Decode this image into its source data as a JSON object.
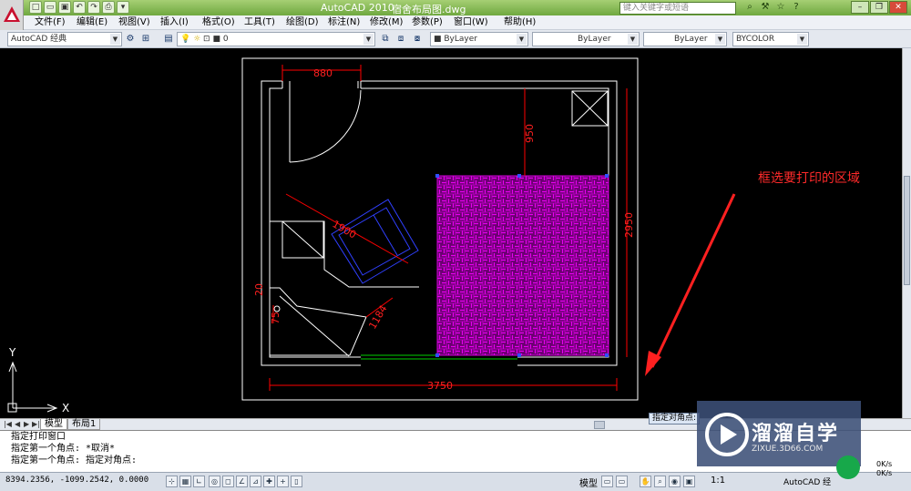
{
  "titlebar": {
    "app_title": "AutoCAD 2010",
    "doc_title": "宿舍布局图.dwg",
    "search_placeholder": "键入关键字或短语"
  },
  "menu": [
    "文件(F)",
    "编辑(E)",
    "视图(V)",
    "插入(I)",
    "格式(O)",
    "工具(T)",
    "绘图(D)",
    "标注(N)",
    "修改(M)",
    "参数(P)",
    "窗口(W)",
    "帮助(H)"
  ],
  "toolbar": {
    "workspace": "AutoCAD 经典",
    "layer": "0",
    "color": "ByLayer",
    "linetype": "ByLayer",
    "lineweight": "ByLayer",
    "plotstyle": "BYCOLOR"
  },
  "drawing": {
    "dim_top": "880",
    "dim_right_inner": "950",
    "dim_right": "2950",
    "dim_bottom": "3750",
    "dim_bed": "1900",
    "dim_desk": "1184",
    "dim_small_1": "20",
    "dim_small_2": "75",
    "annotation": "框选要打印的区域",
    "annotation_color": "#ff2a2a",
    "hatch_color": "#c800c8",
    "dim_color": "#ff0000",
    "ucs_x": "X",
    "ucs_y": "Y"
  },
  "tabs": [
    "模型",
    "布局1"
  ],
  "tooltip": "指定对角点:",
  "command": {
    "lines": [
      "指定打印窗口",
      "指定第一个角点: *取消*",
      "指定第一个角点: 指定对角点:"
    ]
  },
  "status": {
    "coords": "8394.2356,  -1099.2542, 0.0000",
    "model": "模型",
    "scale": "1:1",
    "acad": "AutoCAD 经",
    "net_up": "0K/s",
    "net_down": "0K/s"
  },
  "watermark": {
    "brand": "溜溜自学",
    "url": "ZIXUE.3D66.COM"
  }
}
